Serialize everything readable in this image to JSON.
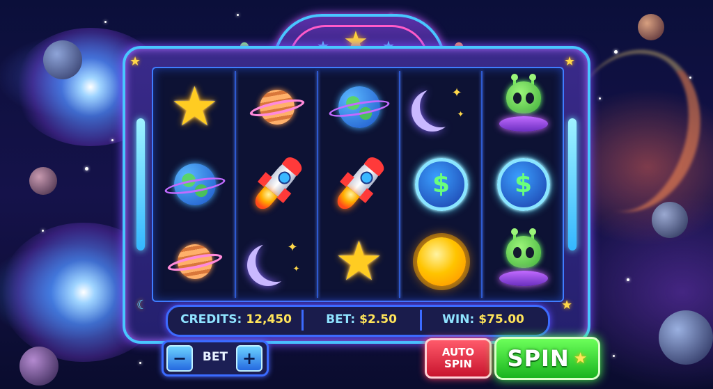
{
  "info": {
    "credits_label": "CREDITS:",
    "credits_value": "12,450",
    "bet_label": "BET:",
    "bet_value": "$2.50",
    "win_label": "WIN:",
    "win_value": "$75.00"
  },
  "controls": {
    "bet_minus": "−",
    "bet_label": "BET",
    "bet_plus": "+",
    "auto_spin_line1": "AUTO",
    "auto_spin_line2": "SPIN",
    "spin_label": "SPIN"
  },
  "reels": [
    [
      "star",
      "earth",
      "saturn"
    ],
    [
      "saturn",
      "rocket",
      "moon"
    ],
    [
      "earth",
      "rocket",
      "star"
    ],
    [
      "moon",
      "dollar-coin",
      "sun"
    ],
    [
      "alien",
      "dollar-coin",
      "alien"
    ]
  ],
  "colors": {
    "frame_border": "#49c6ff",
    "credits_label": "#8fe3ff",
    "value_text": "#ffe45a",
    "spin_button": "#19b41e",
    "auto_spin_button": "#c8142e"
  }
}
